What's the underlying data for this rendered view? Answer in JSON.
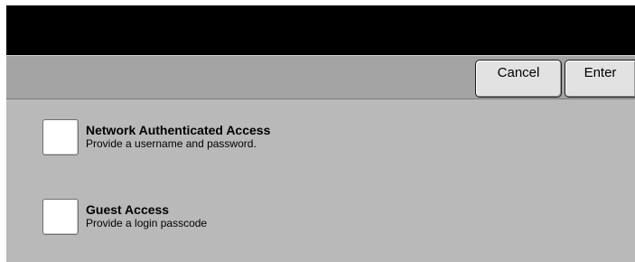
{
  "toolbar": {
    "cancel_label": "Cancel",
    "enter_label": "Enter"
  },
  "options": [
    {
      "title": "Network Authenticated Access",
      "description": "Provide a username and password.",
      "checked": false
    },
    {
      "title": "Guest Access",
      "description": "Provide a login passcode",
      "checked": false
    }
  ],
  "colors": {
    "header": "#000000",
    "toolbar": "#a4a4a4",
    "content": "#b9b9b9",
    "button": "#e2e2e2",
    "checkbox": "#ffffff"
  }
}
